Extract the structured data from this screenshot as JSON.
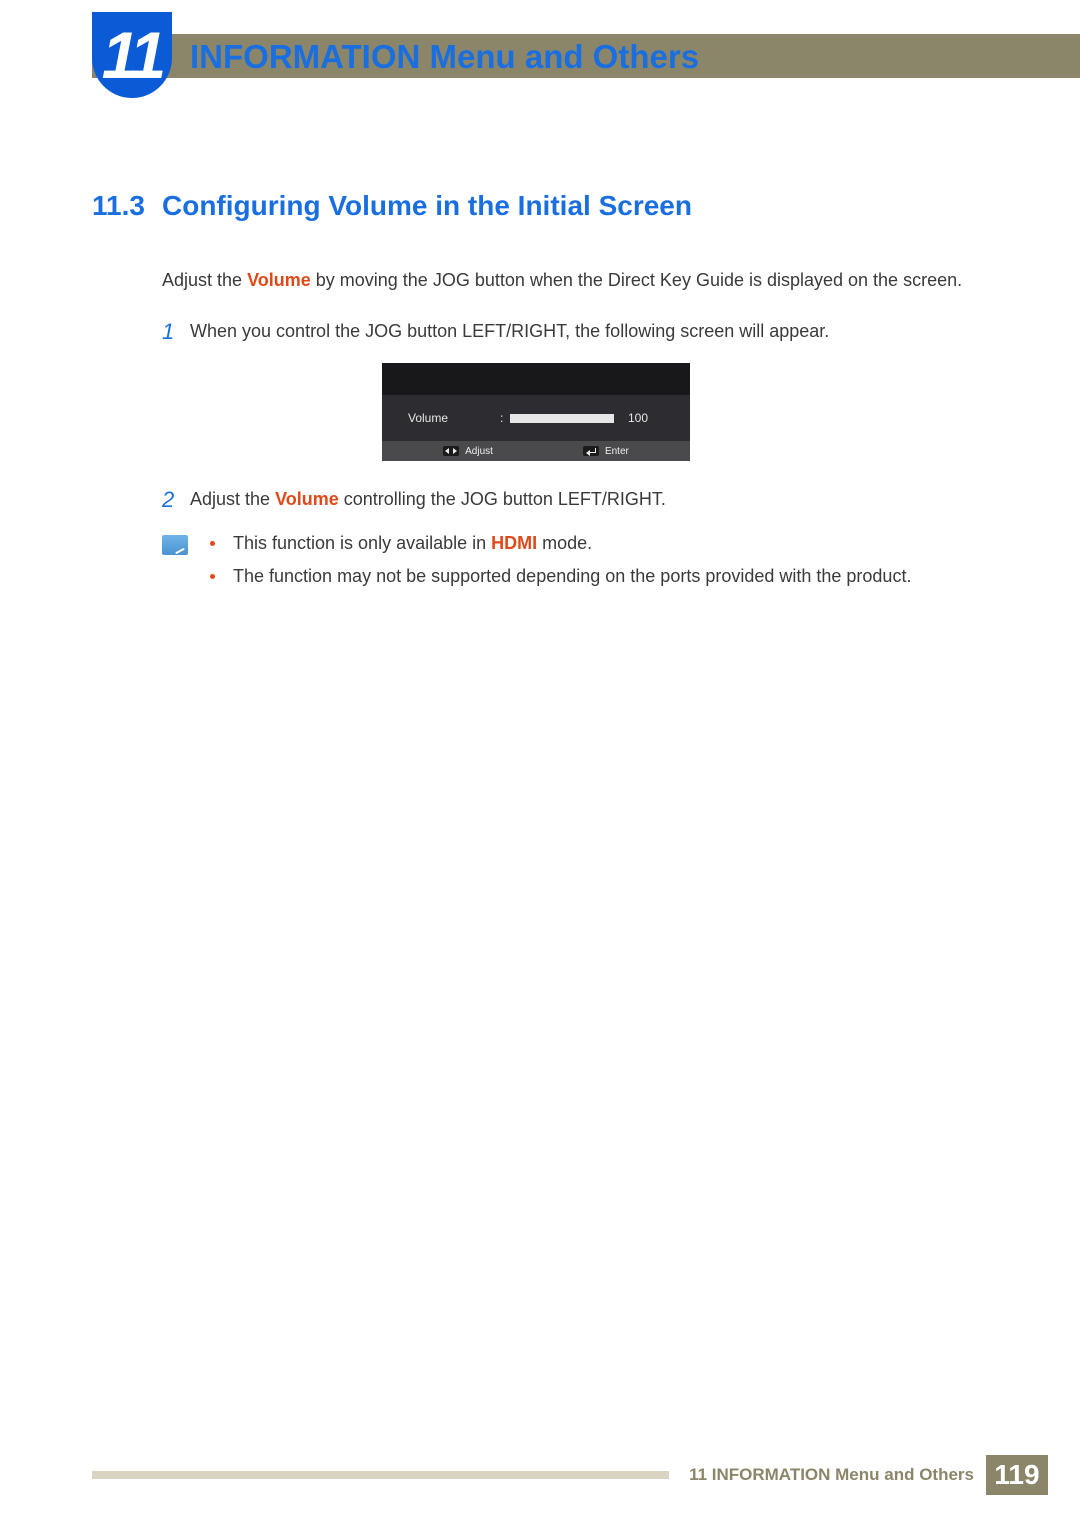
{
  "header": {
    "chapter_number": "11",
    "chapter_title": "INFORMATION Menu and Others"
  },
  "section": {
    "number": "11.3",
    "title": "Configuring Volume in the Initial Screen"
  },
  "intro": {
    "pre": "Adjust the ",
    "hot": "Volume",
    "post": " by moving the JOG button when the Direct Key Guide is displayed on the screen."
  },
  "steps": [
    {
      "num": "1",
      "text": "When you control the JOG button LEFT/RIGHT, the following screen will appear."
    },
    {
      "num": "2",
      "pre": "Adjust the ",
      "hot": "Volume",
      "post": " controlling the JOG button LEFT/RIGHT."
    }
  ],
  "osd": {
    "label": "Volume",
    "colon": ":",
    "value": "100",
    "hint_adjust": "Adjust",
    "hint_enter": "Enter"
  },
  "notes": [
    {
      "pre": "This function is only available in ",
      "hot": "HDMI",
      "post": " mode."
    },
    {
      "text": "The function may not be supported depending on the ports provided with the product."
    }
  ],
  "footer": {
    "text": "11 INFORMATION Menu and Others",
    "page": "119"
  }
}
